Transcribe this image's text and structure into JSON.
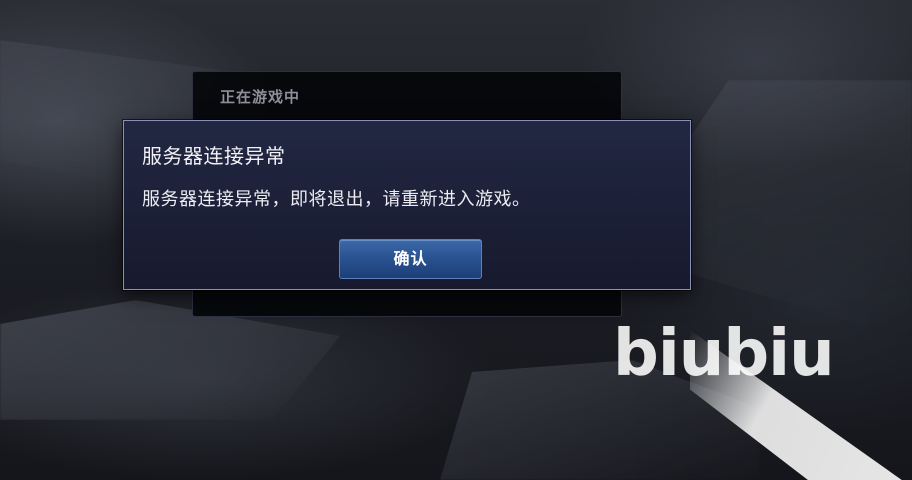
{
  "background_panel": {
    "title": "正在游戏中"
  },
  "dialog": {
    "title": "服务器连接异常",
    "message": "服务器连接异常，即将退出，请重新进入游戏。",
    "confirm_label": "确认"
  },
  "watermark": {
    "text": "biubiu"
  },
  "colors": {
    "dialog_border": "#8a90b6",
    "dialog_bg": "#1f2440",
    "button_bg": "#2a5392",
    "text": "#ececf2",
    "panel_title": "#8d8f9a"
  }
}
